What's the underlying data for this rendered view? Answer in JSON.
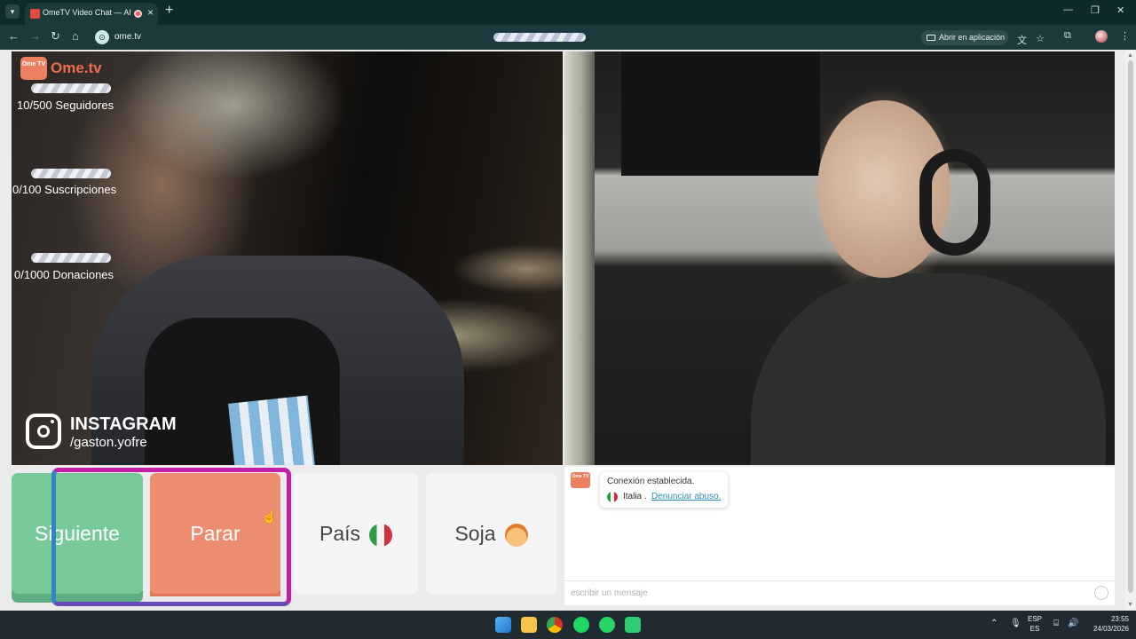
{
  "browser": {
    "tab_list_icon": "chevron-down-icon",
    "tab_title": "OmeTV Video Chat — Alte",
    "new_tab_icon": "plus-icon",
    "url": "ome.tv",
    "open_in_app": "Abrir en aplicación"
  },
  "overlay": {
    "logo_badge": "Ome TV",
    "logo_text": "Ome.tv",
    "stats": [
      {
        "label": "10/500 Seguidores",
        "progress": 0.02
      },
      {
        "label": "0/100 Suscripciones",
        "progress": 0
      },
      {
        "label": "0/1000 Donaciones",
        "progress": 0
      }
    ],
    "instagram_title": "INSTAGRAM",
    "instagram_handle": "/gaston.yofre"
  },
  "controls": {
    "next_label": "Siguiente",
    "stop_label": "Parar",
    "country_label": "País",
    "gender_label": "Soja"
  },
  "chat": {
    "logo_badge": "Ome TV",
    "status_message": "Conexión establecida.",
    "country": "Italia .",
    "report_link": "Denunciar abuso.",
    "input_placeholder": "escribir un mensaje"
  },
  "taskbar": {
    "language_top": "ESP",
    "language_bottom": "ES",
    "time": "23:55",
    "date": "24/03/2026"
  },
  "colors": {
    "next_button": "#77c99a",
    "stop_button": "#ee8c72",
    "brand_orange": "#ee6b4c",
    "link": "#2b8fb0"
  }
}
